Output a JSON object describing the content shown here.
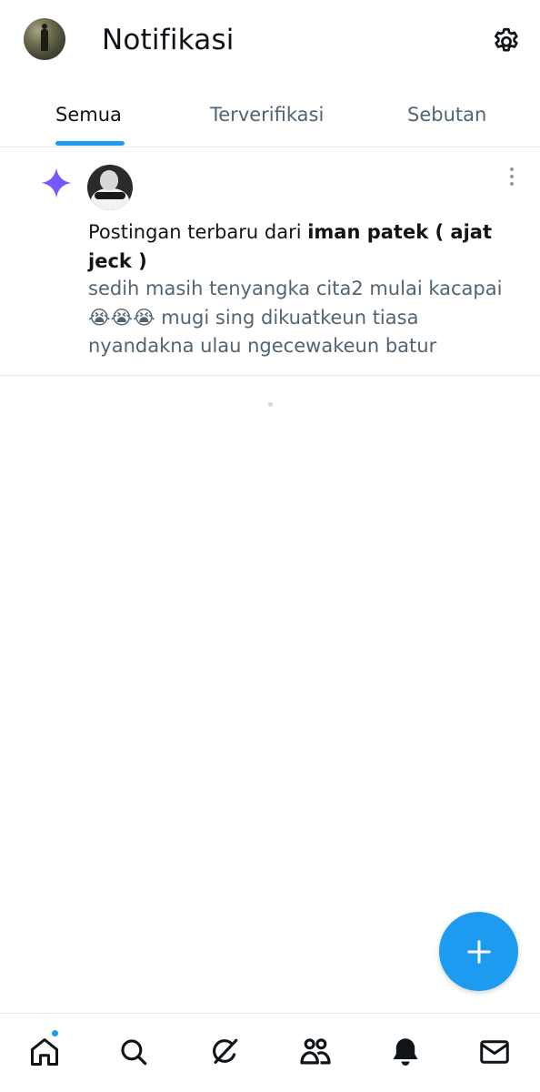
{
  "header": {
    "title": "Notifikasi"
  },
  "tabs": [
    {
      "label": "Semua",
      "active": true
    },
    {
      "label": "Terverifikasi",
      "active": false
    },
    {
      "label": "Sebutan",
      "active": false
    }
  ],
  "notification": {
    "title_prefix": "Postingan terbaru dari ",
    "author": "iman patek ( ajat jeck )",
    "text": "sedih masih tenyangka cita2 mulai kacapai 😭😭😭 mugi sing dikuatkeun tiasa nyandakna ulau ngecewakeun batur",
    "icon": "sparkle-icon"
  },
  "bottom_nav": {
    "items": [
      "home-icon",
      "search-icon",
      "grok-icon",
      "communities-icon",
      "bell-icon",
      "mail-icon"
    ],
    "active": "bell-icon",
    "home_has_badge": true
  },
  "colors": {
    "accent": "#1d9bf0",
    "sparkle": "#7856ff",
    "text_primary": "#0f1419",
    "text_secondary": "#536471"
  }
}
